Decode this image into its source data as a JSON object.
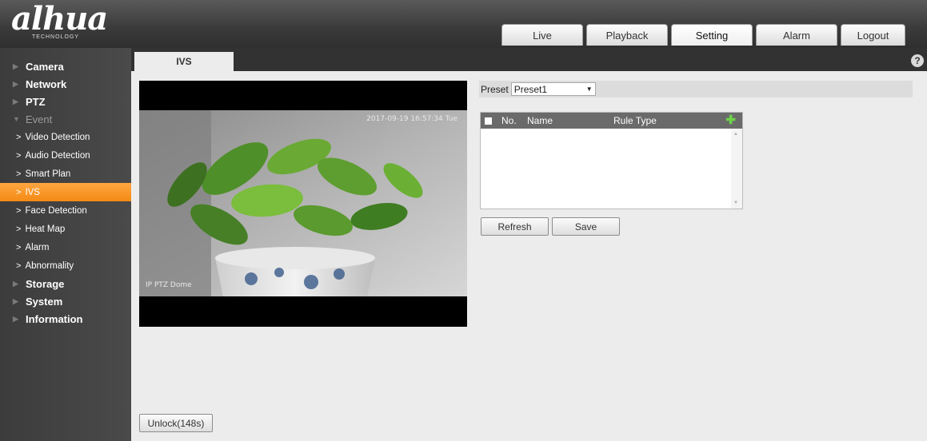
{
  "brand": {
    "name": "alhua",
    "sub": "TECHNOLOGY"
  },
  "topnav": {
    "tabs": [
      {
        "label": "Live"
      },
      {
        "label": "Playback"
      },
      {
        "label": "Setting",
        "active": true
      },
      {
        "label": "Alarm"
      },
      {
        "label": "Logout"
      }
    ]
  },
  "sidebar": {
    "categories": [
      {
        "label": "Camera"
      },
      {
        "label": "Network"
      },
      {
        "label": "PTZ"
      },
      {
        "label": "Event",
        "open": true
      }
    ],
    "event_items": [
      {
        "label": "Video Detection"
      },
      {
        "label": "Audio Detection"
      },
      {
        "label": "Smart Plan"
      },
      {
        "label": "IVS",
        "active": true
      },
      {
        "label": "Face Detection"
      },
      {
        "label": "Heat Map"
      },
      {
        "label": "Alarm"
      },
      {
        "label": "Abnormality"
      }
    ],
    "categories_after": [
      {
        "label": "Storage"
      },
      {
        "label": "System"
      },
      {
        "label": "Information"
      }
    ]
  },
  "content": {
    "tab_label": "IVS",
    "help_icon": "?",
    "video": {
      "timestamp": "2017-09-19 16:57:34 Tue",
      "channel_name": "IP PTZ Dome"
    },
    "preset": {
      "label": "Preset",
      "value": "Preset1"
    },
    "rule_table": {
      "columns": [
        "No.",
        "Name",
        "Rule Type"
      ],
      "rows": []
    },
    "buttons": {
      "refresh": "Refresh",
      "save": "Save",
      "unlock": "Unlock(148s)"
    }
  },
  "colors": {
    "accent": "#f48a14",
    "header_bg": "#3a3a3a",
    "sidebar_bg": "#444444",
    "add_icon": "#6cd34a"
  }
}
